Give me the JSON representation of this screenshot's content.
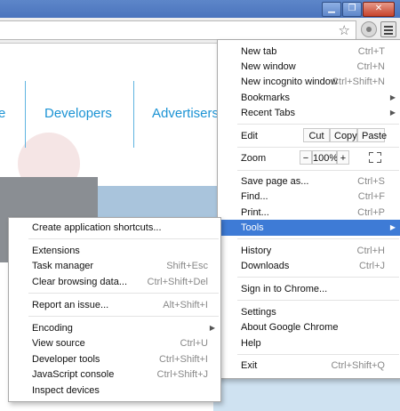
{
  "window": {
    "buttons": {
      "minimize": "▁",
      "maximize": "❐",
      "close": "✕"
    }
  },
  "toolbar": {
    "bookmark_icon": "star-icon",
    "star_glyph": "☆",
    "menu_icon": "hamburger-menu-icon"
  },
  "page": {
    "nav": [
      "e",
      "Developers",
      "Advertisers"
    ]
  },
  "main_menu": {
    "new_tab": {
      "label": "New tab",
      "shortcut": "Ctrl+T"
    },
    "new_window": {
      "label": "New window",
      "shortcut": "Ctrl+N"
    },
    "new_incognito": {
      "label": "New incognito window",
      "shortcut": "Ctrl+Shift+N"
    },
    "bookmarks": {
      "label": "Bookmarks"
    },
    "recent_tabs": {
      "label": "Recent Tabs"
    },
    "edit": {
      "label": "Edit",
      "cut": "Cut",
      "copy": "Copy",
      "paste": "Paste"
    },
    "zoom": {
      "label": "Zoom",
      "minus": "−",
      "value": "100%",
      "plus": "+"
    },
    "save_page": {
      "label": "Save page as...",
      "shortcut": "Ctrl+S"
    },
    "find": {
      "label": "Find...",
      "shortcut": "Ctrl+F"
    },
    "print": {
      "label": "Print...",
      "shortcut": "Ctrl+P"
    },
    "tools": {
      "label": "Tools"
    },
    "history": {
      "label": "History",
      "shortcut": "Ctrl+H"
    },
    "downloads": {
      "label": "Downloads",
      "shortcut": "Ctrl+J"
    },
    "sign_in": {
      "label": "Sign in to Chrome..."
    },
    "settings": {
      "label": "Settings"
    },
    "about": {
      "label": "About Google Chrome"
    },
    "help": {
      "label": "Help"
    },
    "exit": {
      "label": "Exit",
      "shortcut": "Ctrl+Shift+Q"
    },
    "arrow": "▶"
  },
  "tools_menu": {
    "create_shortcuts": {
      "label": "Create application shortcuts..."
    },
    "extensions": {
      "label": "Extensions"
    },
    "task_manager": {
      "label": "Task manager",
      "shortcut": "Shift+Esc"
    },
    "clear_browsing": {
      "label": "Clear browsing data...",
      "shortcut": "Ctrl+Shift+Del"
    },
    "report_issue": {
      "label": "Report an issue...",
      "shortcut": "Alt+Shift+I"
    },
    "encoding": {
      "label": "Encoding"
    },
    "view_source": {
      "label": "View source",
      "shortcut": "Ctrl+U"
    },
    "developer_tools": {
      "label": "Developer tools",
      "shortcut": "Ctrl+Shift+I"
    },
    "js_console": {
      "label": "JavaScript console",
      "shortcut": "Ctrl+Shift+J"
    },
    "inspect_devices": {
      "label": "Inspect devices"
    }
  },
  "colors": {
    "highlight": "#3e7bd6",
    "link": "#1b93d4",
    "titlebar": "#5d86c9"
  }
}
